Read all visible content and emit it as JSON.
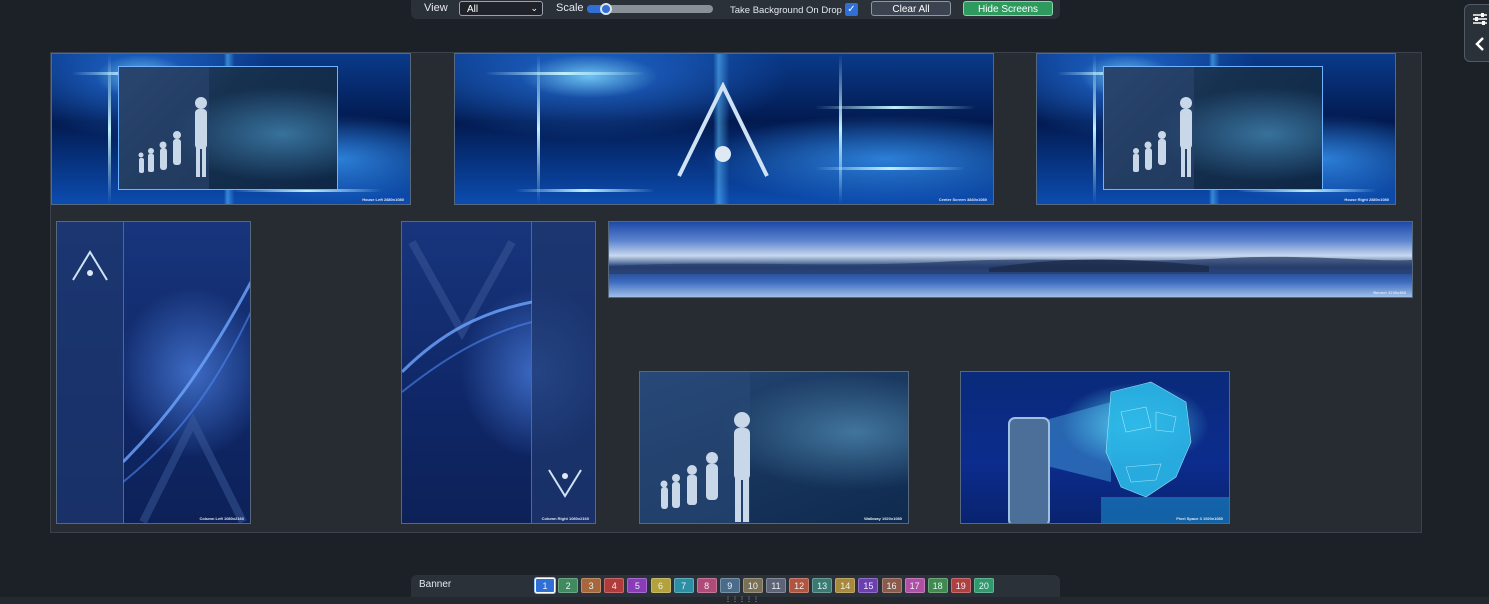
{
  "toolbar": {
    "view_label": "View",
    "view_value": "All",
    "scale_label": "Scale",
    "scale_fraction": 0.15,
    "take_bg_label": "Take Background On Drop",
    "take_bg_checked": true,
    "clear_all_label": "Clear All",
    "hide_screens_label": "Hide Screens"
  },
  "side_panel": {
    "icons": [
      "sliders-icon",
      "chevron-left-icon"
    ]
  },
  "screens": [
    {
      "id": "house-left",
      "caption": "House Left 2880x1080"
    },
    {
      "id": "center-screen",
      "caption": "Center Screen 3840x1080"
    },
    {
      "id": "house-right",
      "caption": "House Right 2880x1080"
    },
    {
      "id": "column-left",
      "caption": "Column Left 1080x2160"
    },
    {
      "id": "column-right",
      "caption": "Column Right 1080x2160"
    },
    {
      "id": "banner",
      "caption": "Banner 3740x360"
    },
    {
      "id": "walkway",
      "caption": "Walkway 1920x1080"
    },
    {
      "id": "pixel-space",
      "caption": "Pixel Space 3 1920x1080"
    }
  ],
  "banner_bar": {
    "label": "Banner",
    "active": 1,
    "chips": [
      {
        "n": "1",
        "color": "#2f6fd6"
      },
      {
        "n": "2",
        "color": "#3f8a5e"
      },
      {
        "n": "3",
        "color": "#a6683a"
      },
      {
        "n": "4",
        "color": "#b03b3b"
      },
      {
        "n": "5",
        "color": "#8a3bb8"
      },
      {
        "n": "6",
        "color": "#b3a23a"
      },
      {
        "n": "7",
        "color": "#2d8fa3"
      },
      {
        "n": "8",
        "color": "#b04a78"
      },
      {
        "n": "9",
        "color": "#4a6c8a"
      },
      {
        "n": "10",
        "color": "#7a7055"
      },
      {
        "n": "11",
        "color": "#5d6478"
      },
      {
        "n": "12",
        "color": "#b0553f"
      },
      {
        "n": "13",
        "color": "#3b7a72"
      },
      {
        "n": "14",
        "color": "#a8893a"
      },
      {
        "n": "15",
        "color": "#6b3fb0"
      },
      {
        "n": "16",
        "color": "#8a5a4a"
      },
      {
        "n": "17",
        "color": "#b04fa5"
      },
      {
        "n": "18",
        "color": "#3f8a4e"
      },
      {
        "n": "19",
        "color": "#b03f3f"
      },
      {
        "n": "20",
        "color": "#2f9a6e"
      }
    ]
  }
}
